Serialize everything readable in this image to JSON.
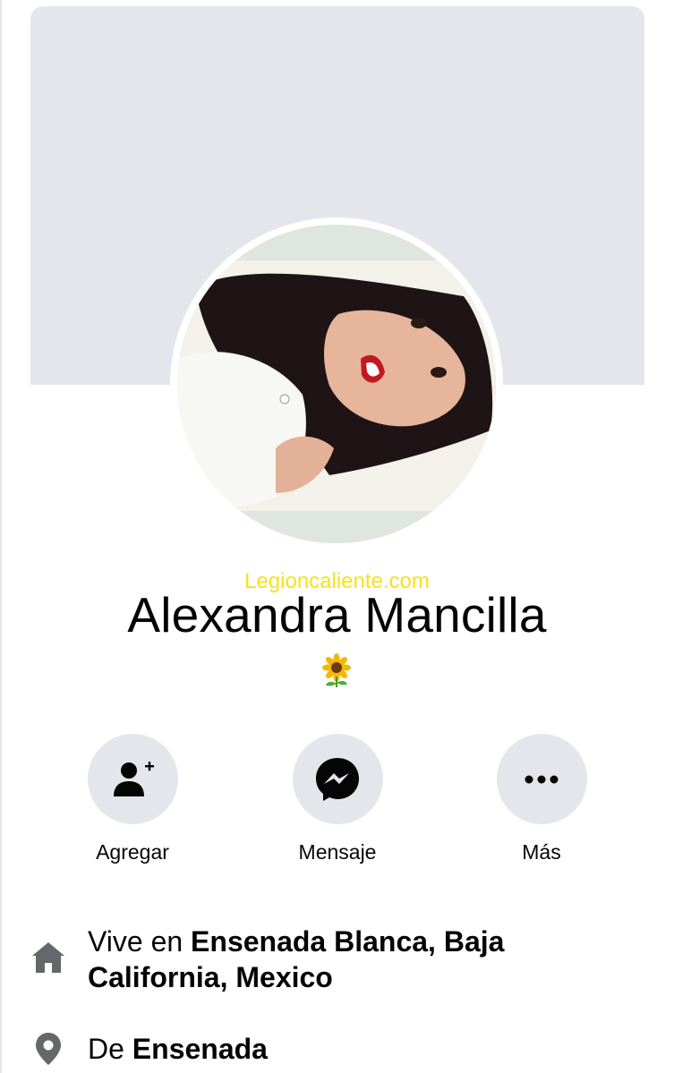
{
  "profile": {
    "watermark": "Legioncaliente.com",
    "name": "Alexandra Mancilla",
    "bio_icon": "sunflower-emoji"
  },
  "actions": [
    {
      "label": "Agregar",
      "icon": "add-friend-icon"
    },
    {
      "label": "Mensaje",
      "icon": "messenger-icon"
    },
    {
      "label": "Más",
      "icon": "more-icon"
    }
  ],
  "details": {
    "lives": {
      "prefix": "Vive en ",
      "place": "Ensenada Blanca, Baja California, Mexico",
      "icon": "home-icon"
    },
    "from": {
      "prefix": "De ",
      "place": "Ensenada",
      "icon": "location-pin-icon"
    }
  },
  "colors": {
    "button_bg": "#e4e6eb",
    "icon": "#050505",
    "detail_icon": "#65676b",
    "watermark": "#f7e21a"
  }
}
